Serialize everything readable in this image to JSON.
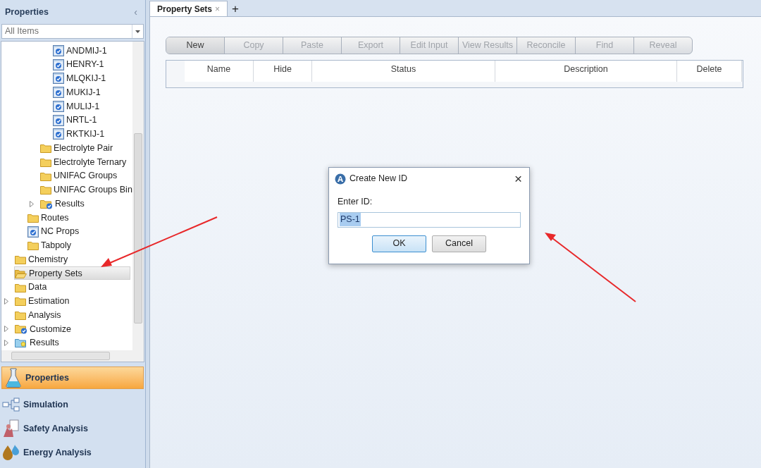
{
  "sidebar": {
    "title": "Properties",
    "collapse_glyph": "‹",
    "filter": {
      "value": "All Items"
    },
    "tree": [
      {
        "children": [
          {
            "children": [
              {
                "children": [
                  {
                    "label": "ANDMIJ-1",
                    "kind": "form",
                    "selected": false
                  },
                  {
                    "label": "HENRY-1",
                    "kind": "form",
                    "selected": false
                  },
                  {
                    "label": "MLQKIJ-1",
                    "kind": "form",
                    "selected": false
                  },
                  {
                    "label": "MUKIJ-1",
                    "kind": "form",
                    "selected": false
                  },
                  {
                    "label": "MULIJ-1",
                    "kind": "form",
                    "selected": false
                  },
                  {
                    "label": "NRTL-1",
                    "kind": "form",
                    "selected": false
                  },
                  {
                    "label": "RKTKIJ-1",
                    "kind": "form",
                    "selected": false
                  }
                ]
              },
              {
                "label": "Electrolyte Pair",
                "kind": "folder",
                "selected": false
              },
              {
                "label": "Electrolyte Ternary",
                "kind": "folder",
                "selected": false
              },
              {
                "label": "UNIFAC Groups",
                "kind": "folder",
                "selected": false
              },
              {
                "label": "UNIFAC Groups Bin",
                "kind": "folder",
                "selected": false
              },
              {
                "label": "Results",
                "kind": "folder-check",
                "expandable": true,
                "selected": false
              }
            ]
          },
          {
            "label": "Routes",
            "kind": "folder",
            "selected": false
          },
          {
            "label": "NC Props",
            "kind": "form",
            "selected": false
          },
          {
            "label": "Tabpoly",
            "kind": "folder",
            "selected": false
          }
        ]
      },
      {
        "label": "Chemistry",
        "kind": "folder",
        "selected": false
      },
      {
        "label": "Property Sets",
        "kind": "folder-open",
        "selected": true
      },
      {
        "label": "Data",
        "kind": "folder",
        "selected": false
      },
      {
        "label": "Estimation",
        "kind": "folder",
        "expandable": true,
        "selected": false
      },
      {
        "label": "Analysis",
        "kind": "folder",
        "selected": false
      },
      {
        "label": "Customize",
        "kind": "folder-check",
        "expandable": true,
        "selected": false
      },
      {
        "label": "Results",
        "kind": "results",
        "expandable": true,
        "selected": false
      }
    ],
    "nav": [
      {
        "label": "Properties",
        "kind": "flask",
        "selected": true
      },
      {
        "label": "Simulation",
        "kind": "flowsheet",
        "selected": false
      },
      {
        "label": "Safety Analysis",
        "kind": "safety",
        "selected": false
      },
      {
        "label": "Energy Analysis",
        "kind": "energy",
        "selected": false
      }
    ]
  },
  "tabs": [
    {
      "label": "Property Sets",
      "close_glyph": "×",
      "selected": true
    }
  ],
  "new_tab_glyph": "+",
  "toolbar": [
    {
      "label": "New",
      "disabled": false
    },
    {
      "label": "Copy",
      "disabled": true
    },
    {
      "label": "Paste",
      "disabled": true
    },
    {
      "label": "Export",
      "disabled": true
    },
    {
      "label": "Edit Input",
      "disabled": true
    },
    {
      "label": "View Results",
      "disabled": true
    },
    {
      "label": "Reconcile",
      "disabled": true
    },
    {
      "label": "Find",
      "disabled": true
    },
    {
      "label": "Reveal",
      "disabled": true
    }
  ],
  "table": {
    "columns": [
      "Name",
      "Hide",
      "Status",
      "Description",
      "Delete"
    ]
  },
  "dialog": {
    "title": "Create New ID",
    "close_glyph": "×",
    "field_label": "Enter ID:",
    "field_value": "PS-1",
    "buttons": [
      {
        "label": "OK",
        "selected": true
      },
      {
        "label": "Cancel",
        "selected": false
      }
    ]
  }
}
